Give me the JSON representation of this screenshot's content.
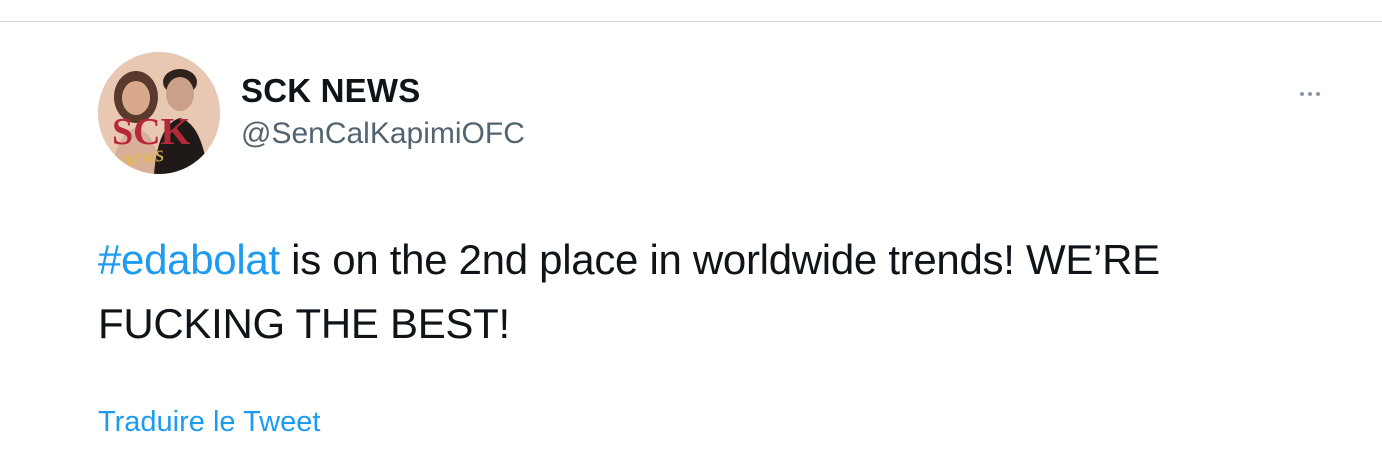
{
  "author": {
    "display_name": "SCK NEWS",
    "handle": "@SenCalKapimiOFC",
    "avatar_logo_text": "SCK",
    "avatar_logo_script": "news"
  },
  "tweet": {
    "hashtag": "#edabolat",
    "text_line1": " is on the 2nd place in worldwide trends! WE’RE",
    "text_line2": "FUCKING THE BEST!"
  },
  "actions": {
    "translate_label": "Traduire le Tweet",
    "more_icon": "more-horizontal-icon"
  },
  "colors": {
    "link": "#1d9bf0",
    "text": "#0f1419",
    "secondary": "#536471",
    "divider": "#cfd9de",
    "avatar_logo": "#b5283a"
  }
}
